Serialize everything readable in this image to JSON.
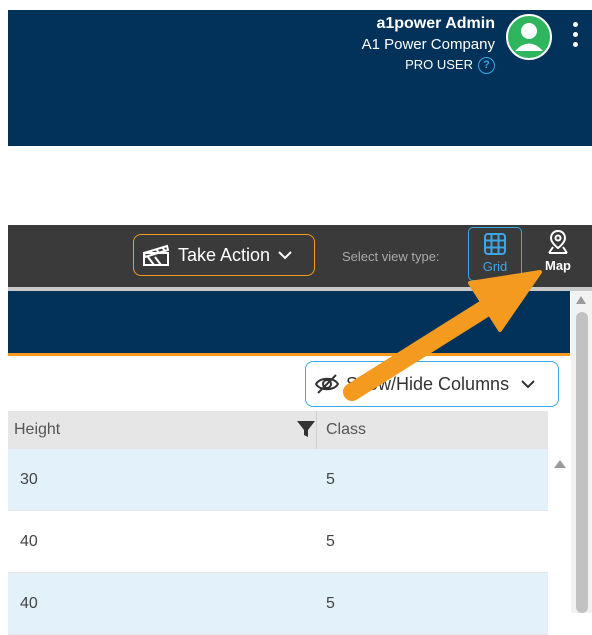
{
  "header": {
    "user_name": "a1power Admin",
    "company": "A1 Power Company",
    "role": "PRO USER",
    "help_glyph": "?"
  },
  "toolbar": {
    "take_action_label": "Take Action",
    "select_view_label": "Select view type:",
    "grid_label": "Grid",
    "map_label": "Map"
  },
  "grid": {
    "show_hide_label": "Show/Hide Columns",
    "columns": [
      "Height",
      "Class"
    ],
    "rows": [
      {
        "height": "30",
        "class": "5"
      },
      {
        "height": "40",
        "class": "5"
      },
      {
        "height": "40",
        "class": "5"
      }
    ]
  },
  "colors": {
    "header_bg": "#02325a",
    "accent_orange": "#f39a1f",
    "accent_blue": "#3aa7e6",
    "toolbar_bg": "#3a3a3a",
    "row_alt": "#e3f1fb"
  },
  "icons": [
    "user-avatar-icon",
    "kebab-menu-icon",
    "help-icon",
    "clapperboard-icon",
    "chevron-down-icon",
    "grid-icon",
    "map-pin-icon",
    "eye-slash-icon",
    "filter-icon",
    "annotation-arrow"
  ]
}
